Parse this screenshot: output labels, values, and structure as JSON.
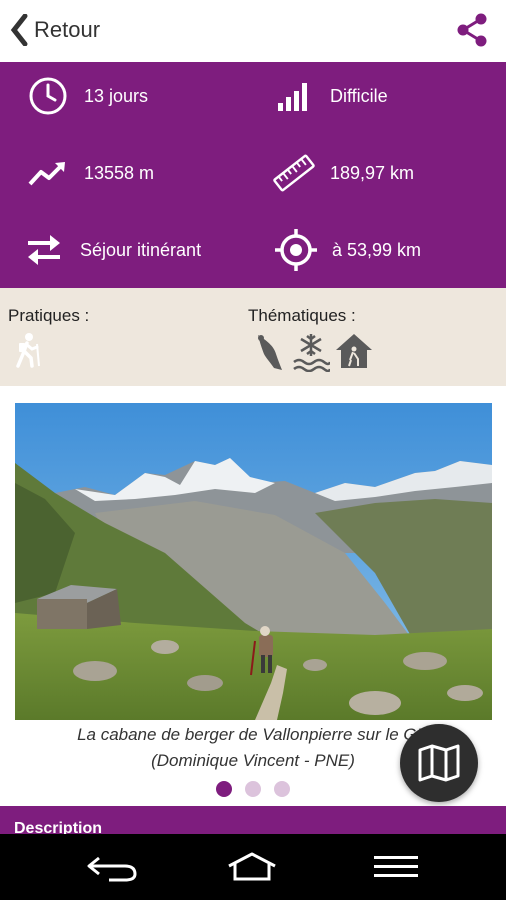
{
  "topbar": {
    "back_label": "Retour",
    "back_icon": "chevron-left-icon",
    "share_icon": "share-icon"
  },
  "stats": {
    "duration": "13 jours",
    "difficulty": "Difficile",
    "elevation": "13558 m",
    "distance": "189,97 km",
    "trip_type": "Séjour itinérant",
    "proximity": "à 53,99 km"
  },
  "categories": {
    "practical_title": "Pratiques :",
    "practical_icons": [
      "hiker-icon"
    ],
    "thematic_title": "Thématiques :",
    "thematic_icons": [
      "bird-icon",
      "snow-water-icon",
      "hut-icon"
    ]
  },
  "gallery": {
    "caption_line1": "La cabane de berger de Vallonpierre sur le GR",
    "caption_line2": "(Dominique Vincent - PNE)",
    "slide_count": 3,
    "active_slide": 1
  },
  "map_button": {
    "icon": "map-icon"
  },
  "description": {
    "label": "Description"
  },
  "colors": {
    "accent": "#7e1d7e",
    "categories_bg": "#eee7dd",
    "navbar_bg": "#000000"
  }
}
